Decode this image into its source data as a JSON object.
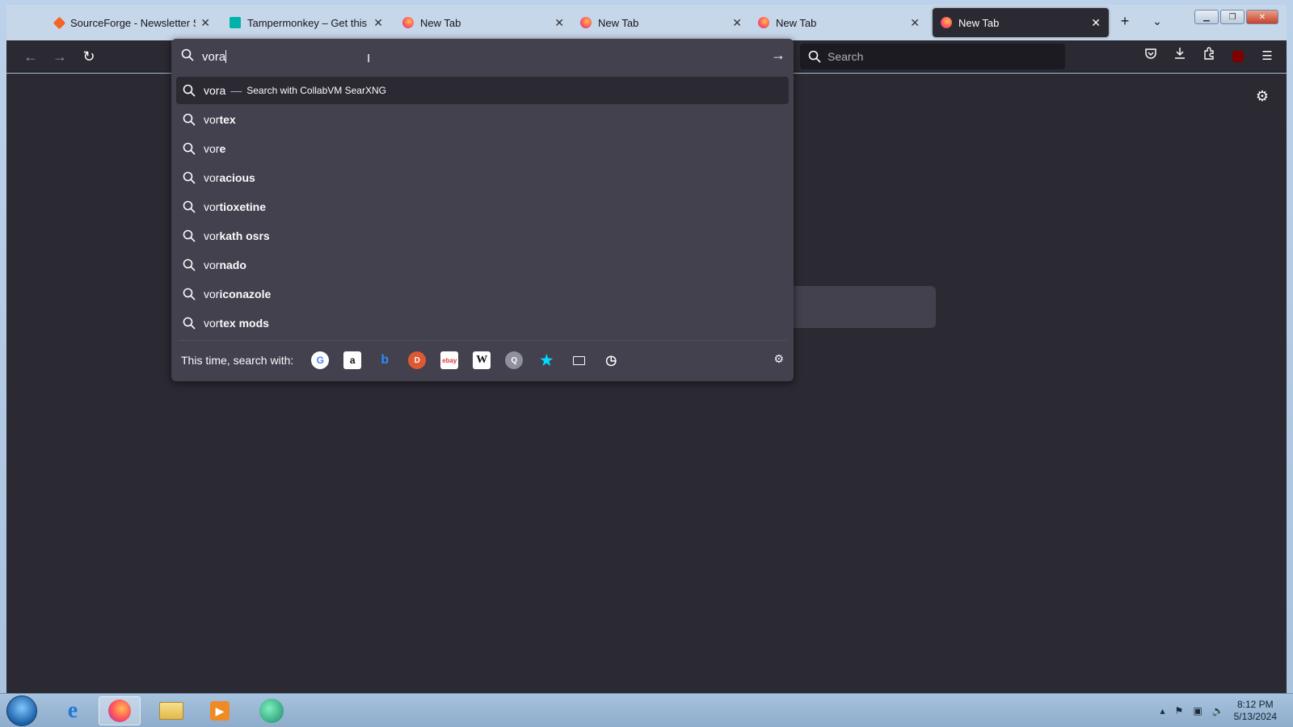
{
  "browser": {
    "tabs": [
      {
        "label": "SourceForge - Newsletter Signu",
        "favicon_color": "#f26522",
        "active": false
      },
      {
        "label": "Tampermonkey – Get this Exte",
        "favicon_color": "#00b2a9",
        "active": false
      },
      {
        "label": "New Tab",
        "favicon_color": "#ff7139",
        "active": false
      },
      {
        "label": "New Tab",
        "favicon_color": "#ff7139",
        "active": false
      },
      {
        "label": "New Tab",
        "favicon_color": "#ff7139",
        "active": false
      },
      {
        "label": "New Tab",
        "favicon_color": "#ff7139",
        "active": true
      }
    ],
    "search_placeholder": "Search"
  },
  "urlbar": {
    "typed": "vora",
    "first_suggestion": {
      "query": "vora",
      "action": "Search with CollabVM SearXNG"
    },
    "suggestions": [
      {
        "prefix": "vor",
        "rest": "tex"
      },
      {
        "prefix": "vor",
        "rest": "e"
      },
      {
        "prefix": "vor",
        "rest": "acious"
      },
      {
        "prefix": "vor",
        "rest": "tioxetine"
      },
      {
        "prefix": "vor",
        "rest": "kath osrs"
      },
      {
        "prefix": "vor",
        "rest": "nado"
      },
      {
        "prefix": "vor",
        "rest": "iconazole"
      },
      {
        "prefix": "vor",
        "rest": "tex mods"
      }
    ],
    "oneoff_label": "This time, search with:",
    "engines": [
      "google-icon",
      "amazon-icon",
      "bing-icon",
      "duckduckgo-icon",
      "ebay-icon",
      "wikipedia-icon",
      "searxng-icon",
      "bookmarks-icon",
      "tabs-icon",
      "history-icon"
    ]
  },
  "taskbar": {
    "time": "8:12 PM",
    "date": "5/13/2024"
  },
  "colors": {
    "toolbar": "#2b2a33",
    "panel": "#42414d",
    "accent": "#00ddff"
  }
}
